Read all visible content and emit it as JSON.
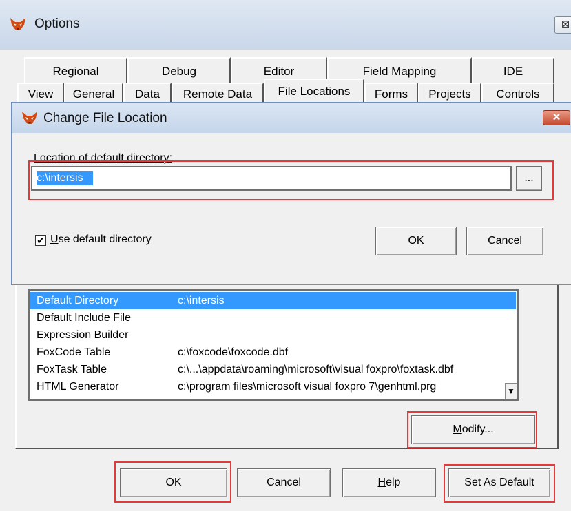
{
  "options_window": {
    "title": "Options",
    "close_glyph": "⊠"
  },
  "tabs_row1": [
    "Regional",
    "Debug",
    "Editor",
    "Field Mapping",
    "IDE"
  ],
  "tabs_row2": [
    "View",
    "General",
    "Data",
    "Remote Data",
    "File Locations",
    "Forms",
    "Projects",
    "Controls"
  ],
  "active_tab": "File Locations",
  "file_list": [
    {
      "type": "Default Directory",
      "location": "c:\\intersis",
      "selected": true
    },
    {
      "type": "Default Include File",
      "location": ""
    },
    {
      "type": "Expression Builder",
      "location": ""
    },
    {
      "type": "FoxCode Table",
      "location": "c:\\foxcode\\foxcode.dbf"
    },
    {
      "type": "FoxTask Table",
      "location": "c:\\...\\appdata\\roaming\\microsoft\\visual foxpro\\foxtask.dbf"
    },
    {
      "type": "HTML Generator",
      "location": "c:\\program files\\microsoft visual foxpro 7\\genhtml.prg"
    }
  ],
  "buttons": {
    "modify": {
      "pre": "",
      "acc": "M",
      "post": "odify..."
    },
    "ok": "OK",
    "cancel": "Cancel",
    "help": {
      "acc": "H",
      "post": "elp"
    },
    "set_default": "Set As Default"
  },
  "dialog": {
    "title": "Change File Location",
    "close_glyph": "✕",
    "label": "Location of default directory:",
    "path_value": "c:\\intersis",
    "browse_label": "...",
    "checkbox_checked": true,
    "checkbox_label_acc": "U",
    "checkbox_label_rest": "se default directory",
    "ok_label": "OK",
    "cancel_label": "Cancel"
  },
  "colors": {
    "selection": "#3399ff",
    "annotation_red": "#e23a3a"
  }
}
